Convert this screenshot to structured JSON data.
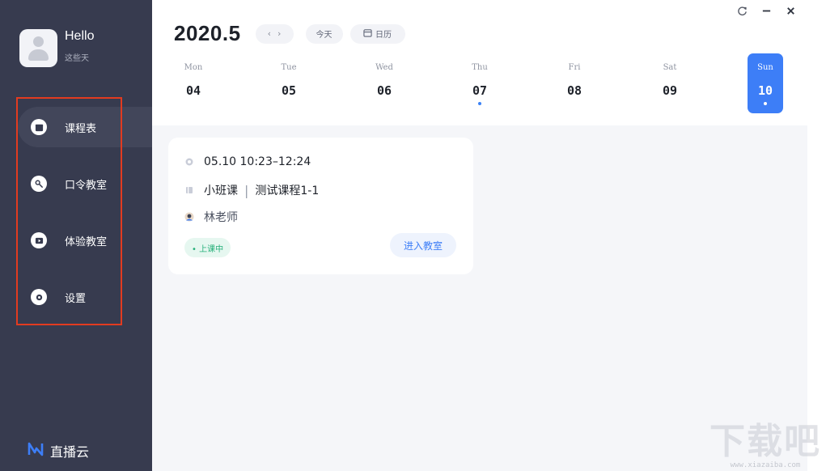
{
  "user": {
    "name": "Hello",
    "subtitle": "这些天"
  },
  "menu": {
    "items": [
      {
        "label": "课程表",
        "icon": "calendar-icon",
        "active": true
      },
      {
        "label": "口令教室",
        "icon": "key-icon",
        "active": false
      },
      {
        "label": "体验教室",
        "icon": "play-icon",
        "active": false
      },
      {
        "label": "设置",
        "icon": "gear-icon",
        "active": false
      }
    ]
  },
  "brand": {
    "name": "直播云",
    "icon": "brand-logo-icon",
    "color": "#3d7ef7"
  },
  "window": {
    "refresh_icon": "refresh-icon",
    "minimize_icon": "minimize-icon",
    "close_icon": "close-icon"
  },
  "header": {
    "month": "2020.5",
    "prev_label": "‹",
    "next_label": "›",
    "today_label": "今天",
    "calendar_label": "日历"
  },
  "week": [
    {
      "name": "Mon",
      "num": "04",
      "dot": false,
      "selected": false
    },
    {
      "name": "Tue",
      "num": "05",
      "dot": false,
      "selected": false
    },
    {
      "name": "Wed",
      "num": "06",
      "dot": false,
      "selected": false
    },
    {
      "name": "Thu",
      "num": "07",
      "dot": true,
      "selected": false
    },
    {
      "name": "Fri",
      "num": "08",
      "dot": false,
      "selected": false
    },
    {
      "name": "Sat",
      "num": "09",
      "dot": false,
      "selected": false
    },
    {
      "name": "Sun",
      "num": "10",
      "dot": true,
      "selected": true
    }
  ],
  "course": {
    "time": "05.10  10:23–12:24",
    "type": "小班课",
    "title": "测试课程1-1",
    "teacher": "林老师",
    "status": "• 上课中",
    "enter_label": "进入教室"
  },
  "colors": {
    "sidebar_bg": "#373b4f",
    "accent": "#3d7ef7",
    "status_green": "#26b07a",
    "highlight_red": "#e23b20"
  },
  "watermark": {
    "main": "下载吧",
    "sub": "www.xiazaiba.com"
  }
}
